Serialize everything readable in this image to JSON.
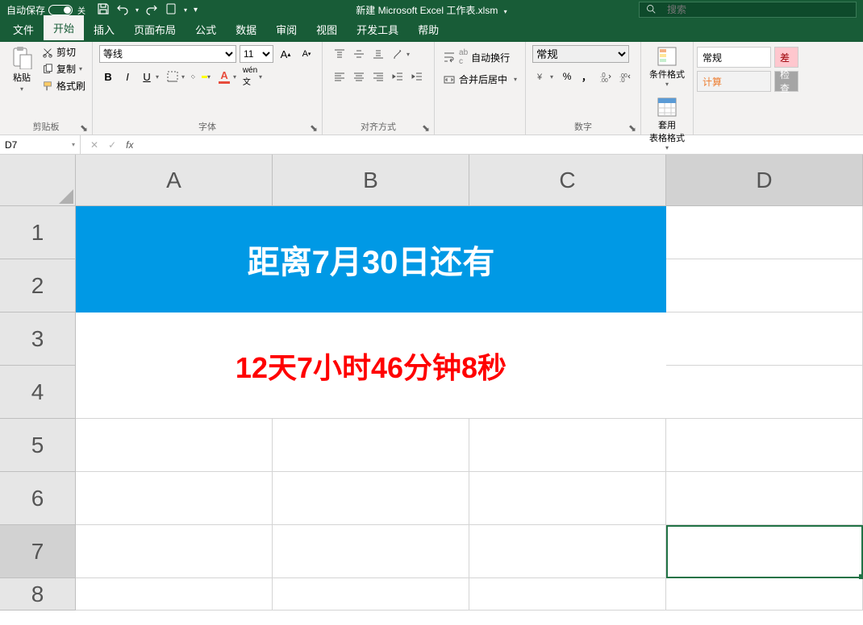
{
  "titlebar": {
    "autosave_label": "自动保存",
    "autosave_state": "关",
    "filename": "新建 Microsoft Excel 工作表.xlsm",
    "search_placeholder": "搜索"
  },
  "tabs": {
    "file": "文件",
    "home": "开始",
    "insert": "插入",
    "layout": "页面布局",
    "formulas": "公式",
    "data": "数据",
    "review": "审阅",
    "view": "视图",
    "developer": "开发工具",
    "help": "帮助"
  },
  "ribbon": {
    "clipboard": {
      "label": "剪贴板",
      "paste": "粘贴",
      "cut": "剪切",
      "copy": "复制",
      "painter": "格式刷"
    },
    "font": {
      "label": "字体",
      "name": "等线",
      "size": "11"
    },
    "align": {
      "label": "对齐方式"
    },
    "wrap": {
      "wrap_text": "自动换行",
      "merge": "合并后居中"
    },
    "number": {
      "label": "数字",
      "format": "常规"
    },
    "styles": {
      "cond": "条件格式",
      "table": "套用\n表格格式"
    },
    "cellstyles": {
      "normal": "常规",
      "bad": "差",
      "calc": "计算",
      "check": "检查"
    }
  },
  "formula_bar": {
    "name_box": "D7"
  },
  "grid": {
    "columns": [
      "A",
      "B",
      "C",
      "D"
    ],
    "rows": [
      "1",
      "2",
      "3",
      "4",
      "5",
      "6",
      "7",
      "8"
    ],
    "title_cell": "距离7月30日还有",
    "countdown_cell": "12天7小时46分钟8秒",
    "active_cell": "D7"
  }
}
